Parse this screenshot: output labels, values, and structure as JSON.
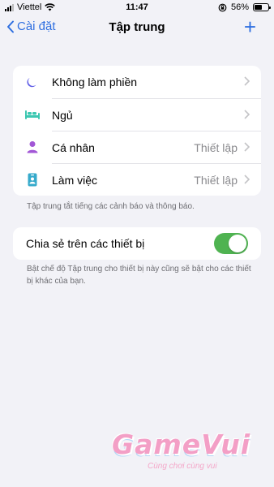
{
  "status_bar": {
    "carrier": "Viettel",
    "time": "11:47",
    "battery_percent": "56%",
    "battery_level": 0.56
  },
  "nav": {
    "back_label": "Cài đặt",
    "title": "Tập trung",
    "add_label": "+"
  },
  "focus_modes": [
    {
      "label": "Không làm phiền",
      "value": "",
      "icon": "moon-icon",
      "icon_color": "#5e5ce6"
    },
    {
      "label": "Ngủ",
      "value": "",
      "icon": "bed-icon",
      "icon_color": "#3cc7b1"
    },
    {
      "label": "Cá nhân",
      "value": "Thiết lập",
      "icon": "person-icon",
      "icon_color": "#a257d6"
    },
    {
      "label": "Làm việc",
      "value": "Thiết lập",
      "icon": "work-badge-icon",
      "icon_color": "#36aacb"
    }
  ],
  "focus_footnote": "Tập trung tắt tiếng các cảnh báo và thông báo.",
  "share": {
    "label": "Chia sẻ trên các thiết bị",
    "enabled": true,
    "toggle_color": "#4fb351"
  },
  "share_footnote": "Bật chế độ Tập trung cho thiết bị này cũng sẽ bật cho các thiết bị khác của bạn.",
  "watermark": {
    "title": "GameVui",
    "subtitle": "Cùng chơi cùng vui"
  }
}
